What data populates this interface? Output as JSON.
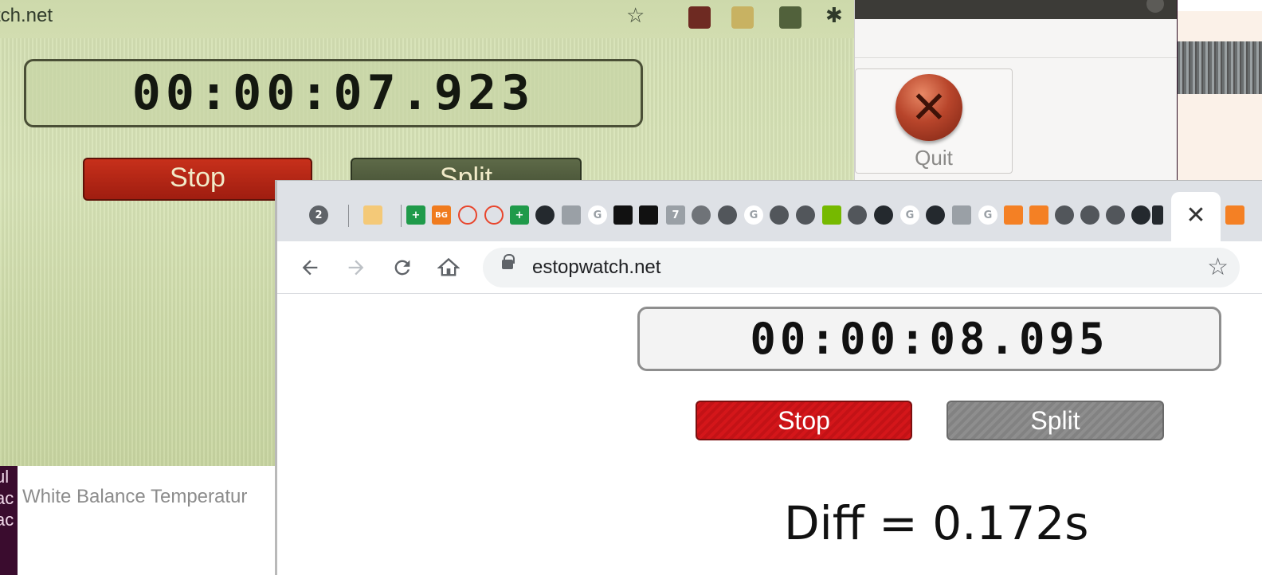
{
  "photo": {
    "url_fragment": "tch.net",
    "timer": "00:00:07.923",
    "stop_label": "Stop",
    "split_label": "Split"
  },
  "dialog": {
    "quit_label": "Quit"
  },
  "lower_panel": {
    "dock_letters": [
      "ul",
      "ac",
      "ac"
    ],
    "wb_label": "White Balance Temperatur"
  },
  "browser": {
    "tab_badge": "2",
    "url": "estopwatch.net",
    "close_tab": "✕",
    "timer": "00:00:08.095",
    "stop_label": "Stop",
    "split_label": "Split",
    "diff_text": "Diff = 0.172s"
  },
  "colors": {
    "stop_red": "#d4161a",
    "split_gray": "#8e8e8e",
    "chrome_tabstrip": "#dee1e6"
  }
}
